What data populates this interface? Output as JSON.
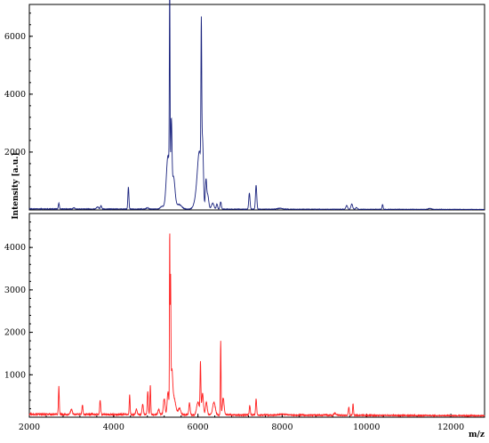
{
  "chart_data": [
    {
      "type": "line",
      "color": "#1a237e",
      "xlim": [
        2000,
        12800
      ],
      "ylim": [
        0,
        7100
      ],
      "yticks": [
        2000,
        4000,
        6000
      ],
      "ytick_labels": [
        "2000",
        "4000",
        "6000"
      ],
      "ylabel": "Intensity [a.u.]",
      "series": [
        {
          "baseline": 35,
          "peaks": [
            [
              2700,
              200,
              12
            ],
            [
              3060,
              40,
              20
            ],
            [
              3620,
              70,
              25
            ],
            [
              3700,
              110,
              15
            ],
            [
              4350,
              760,
              12
            ],
            [
              4800,
              40,
              30
            ],
            [
              5150,
              90,
              40
            ],
            [
              5290,
              1850,
              40
            ],
            [
              5330,
              6780,
              8
            ],
            [
              5370,
              2500,
              14
            ],
            [
              5420,
              1100,
              35
            ],
            [
              5550,
              160,
              60
            ],
            [
              5990,
              550,
              60
            ],
            [
              6040,
              1600,
              45
            ],
            [
              6080,
              4780,
              9
            ],
            [
              6110,
              1900,
              20
            ],
            [
              6190,
              900,
              15
            ],
            [
              6230,
              500,
              25
            ],
            [
              6350,
              200,
              30
            ],
            [
              6450,
              180,
              15
            ],
            [
              6540,
              250,
              15
            ],
            [
              7220,
              550,
              15
            ],
            [
              7380,
              830,
              15
            ],
            [
              7950,
              30,
              60
            ],
            [
              9530,
              130,
              20
            ],
            [
              9650,
              180,
              20
            ],
            [
              9760,
              60,
              20
            ],
            [
              10380,
              170,
              12
            ],
            [
              11500,
              30,
              40
            ]
          ]
        }
      ]
    },
    {
      "type": "line",
      "color": "#ff2020",
      "xlim": [
        2000,
        12800
      ],
      "ylim": [
        0,
        4800
      ],
      "xticks": [
        2000,
        4000,
        6000,
        8000,
        10000,
        12000
      ],
      "xtick_labels": [
        "2000",
        "4000",
        "6000",
        "8000",
        "10000",
        "12000"
      ],
      "yticks": [
        1000,
        2000,
        3000,
        4000
      ],
      "ytick_labels": [
        "1000",
        "2000",
        "3000",
        "4000"
      ],
      "xlabel": "m/z",
      "series": [
        {
          "baseline": 70,
          "peaks": [
            [
              2700,
              650,
              10
            ],
            [
              3000,
              120,
              20
            ],
            [
              3260,
              220,
              12
            ],
            [
              3680,
              340,
              12
            ],
            [
              4380,
              460,
              10
            ],
            [
              4540,
              140,
              15
            ],
            [
              4690,
              250,
              15
            ],
            [
              4810,
              560,
              12
            ],
            [
              4870,
              690,
              10
            ],
            [
              5070,
              120,
              20
            ],
            [
              5200,
              380,
              20
            ],
            [
              5290,
              540,
              20
            ],
            [
              5330,
              4130,
              6
            ],
            [
              5350,
              3000,
              8
            ],
            [
              5380,
              900,
              20
            ],
            [
              5430,
              400,
              40
            ],
            [
              5560,
              150,
              30
            ],
            [
              5800,
              280,
              15
            ],
            [
              6000,
              300,
              30
            ],
            [
              6060,
              1200,
              10
            ],
            [
              6110,
              500,
              20
            ],
            [
              6200,
              300,
              20
            ],
            [
              6380,
              300,
              30
            ],
            [
              6540,
              1750,
              8
            ],
            [
              6600,
              400,
              20
            ],
            [
              7230,
              220,
              12
            ],
            [
              7380,
              380,
              12
            ],
            [
              8000,
              20,
              80
            ],
            [
              9250,
              50,
              20
            ],
            [
              9580,
              190,
              12
            ],
            [
              9680,
              270,
              10
            ]
          ]
        }
      ]
    }
  ]
}
